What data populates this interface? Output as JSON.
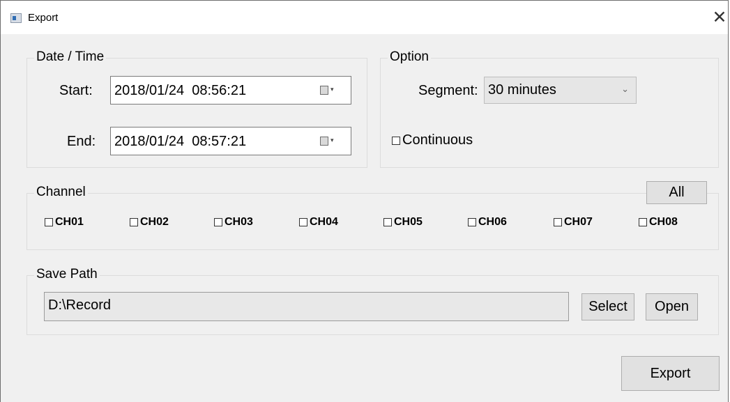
{
  "window": {
    "title": "Export",
    "app_icon": "app-window-icon",
    "close_icon": "close-icon",
    "close_glyph": "✕"
  },
  "date_time": {
    "legend": "Date / Time",
    "start_label": "Start:",
    "start_value": "2018/01/24  08:56:21",
    "end_label": "End:",
    "end_value": "2018/01/24  08:57:21",
    "dropdown_glyph": "▾"
  },
  "option": {
    "legend": "Option",
    "segment_label": "Segment:",
    "segment_value": "30 minutes",
    "segment_arrow": "⌄",
    "continuous_label": "Continuous",
    "continuous_checked": false
  },
  "channel": {
    "legend": "Channel",
    "all_label": "All",
    "items": [
      {
        "label": "CH01",
        "checked": false
      },
      {
        "label": "CH02",
        "checked": false
      },
      {
        "label": "CH03",
        "checked": false
      },
      {
        "label": "CH04",
        "checked": false
      },
      {
        "label": "CH05",
        "checked": false
      },
      {
        "label": "CH06",
        "checked": false
      },
      {
        "label": "CH07",
        "checked": false
      },
      {
        "label": "CH08",
        "checked": false
      }
    ]
  },
  "save_path": {
    "legend": "Save Path",
    "value": "D:\\Record",
    "select_label": "Select",
    "open_label": "Open"
  },
  "export_label": "Export"
}
